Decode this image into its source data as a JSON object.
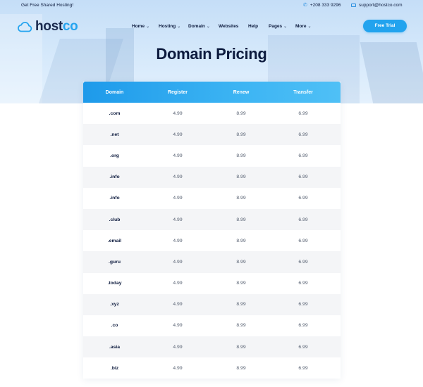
{
  "topbar": {
    "promo": "Get Free Shared Hosting!",
    "phone": "+208 333 9296",
    "email": "support@hostco.com"
  },
  "brand": {
    "part1": "host",
    "part2": "co"
  },
  "nav": {
    "home": "Home",
    "hosting": "Hosting",
    "domain": "Domain",
    "websites": "Websites",
    "help": "Help",
    "pages": "Pages",
    "more": "More"
  },
  "cta": "Free Trial",
  "page_title": "Domain Pricing",
  "table": {
    "headers": [
      "Domain",
      "Register",
      "Renew",
      "Transfer"
    ],
    "rows": [
      [
        ".com",
        "4.99",
        "8.99",
        "6.99"
      ],
      [
        ".net",
        "4.99",
        "8.99",
        "6.99"
      ],
      [
        ".org",
        "4.99",
        "8.99",
        "6.99"
      ],
      [
        ".info",
        "4.99",
        "8.99",
        "6.99"
      ],
      [
        ".info",
        "4.99",
        "8.99",
        "6.99"
      ],
      [
        ".club",
        "4.99",
        "8.99",
        "6.99"
      ],
      [
        ".email",
        "4.99",
        "8.99",
        "6.99"
      ],
      [
        ".guru",
        "4.99",
        "8.99",
        "6.99"
      ],
      [
        ".today",
        "4.99",
        "8.99",
        "6.99"
      ],
      [
        ".xyz",
        "4.99",
        "8.99",
        "6.99"
      ],
      [
        ".co",
        "4.99",
        "8.99",
        "6.99"
      ],
      [
        ".asia",
        "4.99",
        "8.99",
        "6.99"
      ],
      [
        ".biz",
        "4.99",
        "8.99",
        "6.99"
      ]
    ]
  },
  "icons": {
    "phone": "phone-icon",
    "email": "mail-icon",
    "logo": "cloud-icon",
    "dropdown": "chevron-down-icon"
  },
  "colors": {
    "accent": "#22a3ee",
    "navy": "#0d1b3e",
    "table_header_start": "#1e9aea",
    "table_header_end": "#4fc0f6",
    "row_alt": "#f4f5f7"
  }
}
